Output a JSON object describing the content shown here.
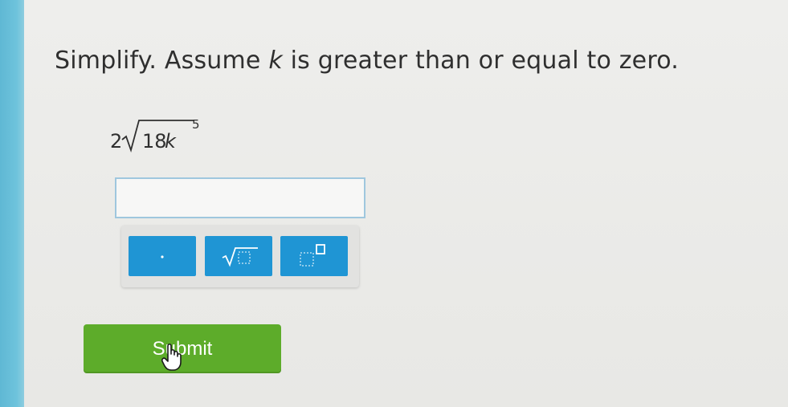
{
  "question": {
    "prefix": "Simplify. Assume ",
    "variable": "k",
    "suffix": " is greater than or equal to zero."
  },
  "expression": {
    "coefficient": "2",
    "radicand": "18",
    "radicand_variable": "k",
    "exponent": "5"
  },
  "answer_input": {
    "value": ""
  },
  "keypad": {
    "keys": [
      {
        "icon": "decimal-point-icon"
      },
      {
        "icon": "square-root-icon"
      },
      {
        "icon": "exponent-icon"
      }
    ]
  },
  "submit_label": "Submit",
  "colors": {
    "key_blue": "#1f95d4",
    "submit_green": "#5dac2a",
    "input_border": "#9fc7de",
    "left_edge": "#6ec3dc"
  }
}
